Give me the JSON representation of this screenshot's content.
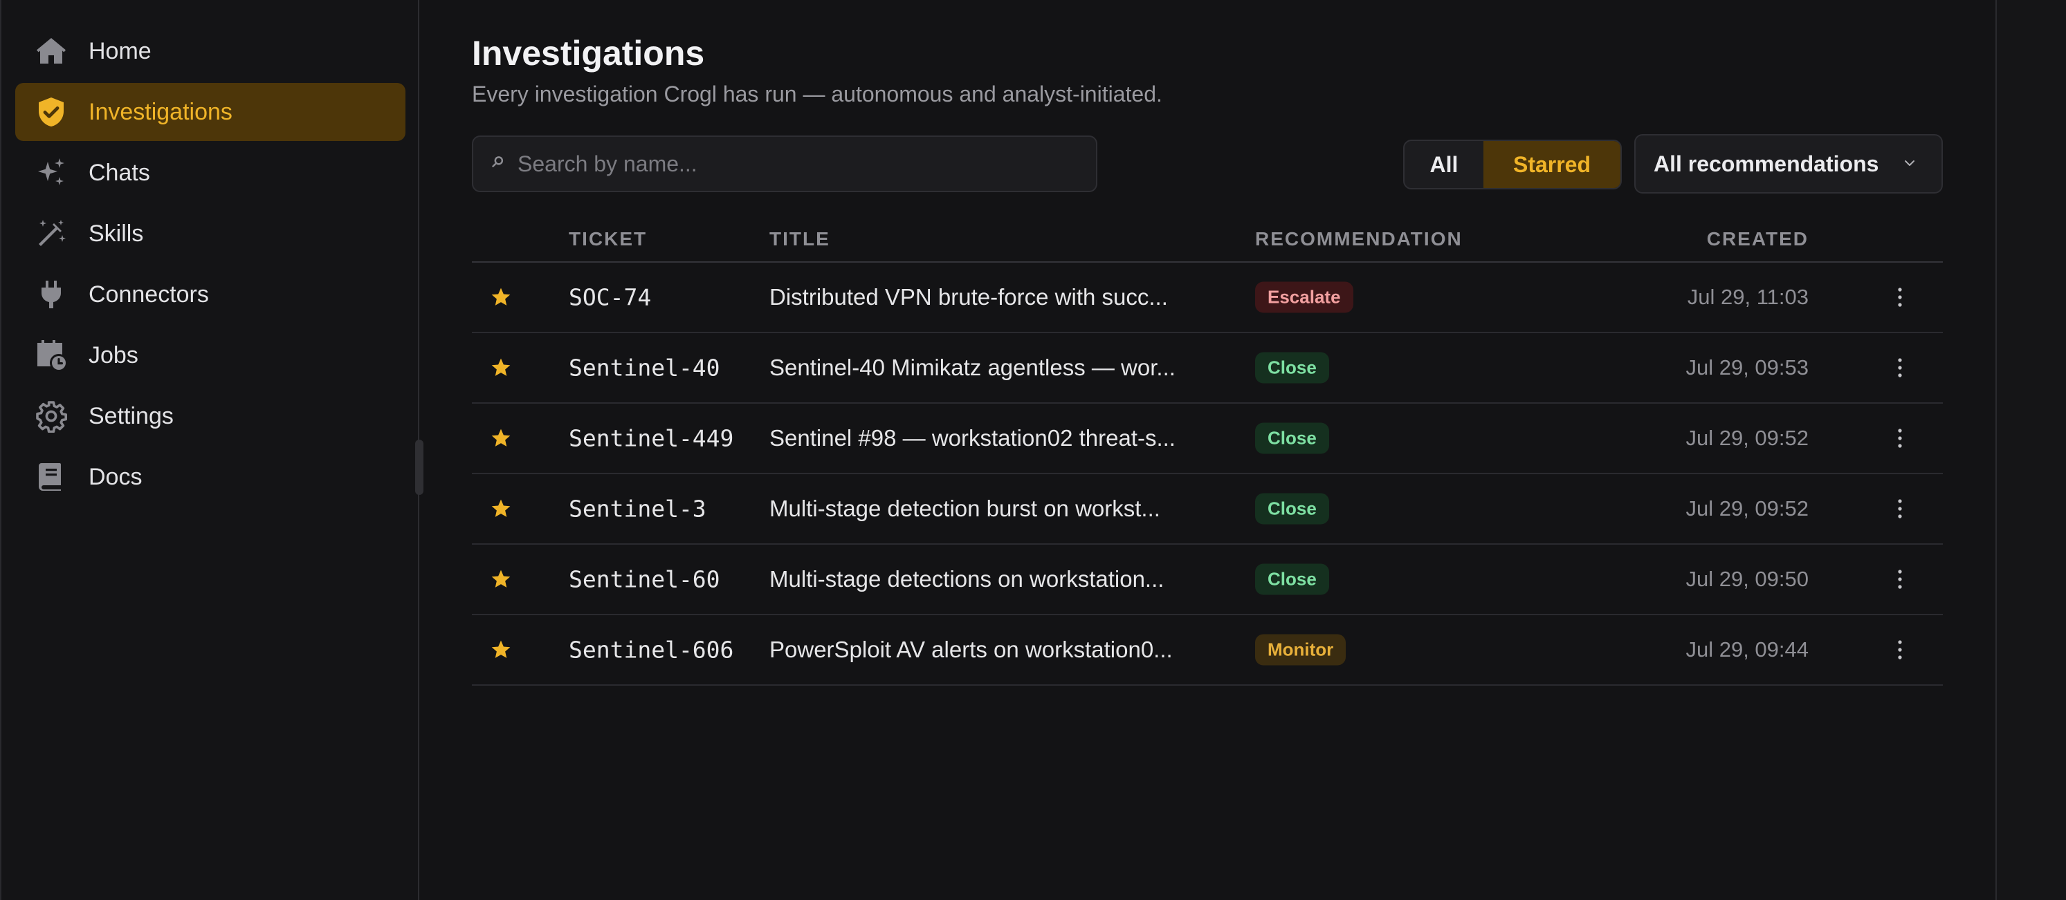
{
  "sidebar": {
    "items": [
      {
        "label": "Home",
        "icon": "home-icon",
        "active": false
      },
      {
        "label": "Investigations",
        "icon": "shield-check-icon",
        "active": true
      },
      {
        "label": "Chats",
        "icon": "sparkles-icon",
        "active": false
      },
      {
        "label": "Skills",
        "icon": "magic-wand-icon",
        "active": false
      },
      {
        "label": "Connectors",
        "icon": "plug-icon",
        "active": false
      },
      {
        "label": "Jobs",
        "icon": "calendar-clock-icon",
        "active": false
      },
      {
        "label": "Settings",
        "icon": "gear-icon",
        "active": false
      },
      {
        "label": "Docs",
        "icon": "book-icon",
        "active": false
      }
    ]
  },
  "header": {
    "title": "Investigations",
    "subtitle": "Every investigation Crogl has run — autonomous and analyst-initiated."
  },
  "search": {
    "placeholder": "Search by name...",
    "value": "",
    "icon": "search-icon"
  },
  "filter": {
    "all_label": "All",
    "starred_label": "Starred",
    "selected": "Starred"
  },
  "recommendation_filter": {
    "selected": "All recommendations"
  },
  "table": {
    "headers": {
      "ticket": "TICKET",
      "title": "TITLE",
      "recommendation": "RECOMMENDATION",
      "created": "CREATED"
    },
    "rows": [
      {
        "starred": true,
        "ticket": "SOC-74",
        "title": "Distributed VPN brute-force with succ...",
        "recommendation": "Escalate",
        "created": "Jul 29, 11:03"
      },
      {
        "starred": true,
        "ticket": "Sentinel-40",
        "title": "Sentinel-40 Mimikatz agentless — wor...",
        "recommendation": "Close",
        "created": "Jul 29, 09:53"
      },
      {
        "starred": true,
        "ticket": "Sentinel-449",
        "title": "Sentinel #98 — workstation02 threat-s...",
        "recommendation": "Close",
        "created": "Jul 29, 09:52"
      },
      {
        "starred": true,
        "ticket": "Sentinel-3",
        "title": "Multi-stage detection burst on workst...",
        "recommendation": "Close",
        "created": "Jul 29, 09:52"
      },
      {
        "starred": true,
        "ticket": "Sentinel-60",
        "title": "Multi-stage detections on workstation...",
        "recommendation": "Close",
        "created": "Jul 29, 09:50"
      },
      {
        "starred": true,
        "ticket": "Sentinel-606",
        "title": "PowerSploit AV alerts on workstation0...",
        "recommendation": "Monitor",
        "created": "Jul 29, 09:44"
      }
    ]
  },
  "colors": {
    "accent": "#f0b428",
    "active_bg": "#4d3609",
    "escalate": "#f2a0a0",
    "close": "#7ee0a3",
    "monitor": "#e8b03a"
  }
}
